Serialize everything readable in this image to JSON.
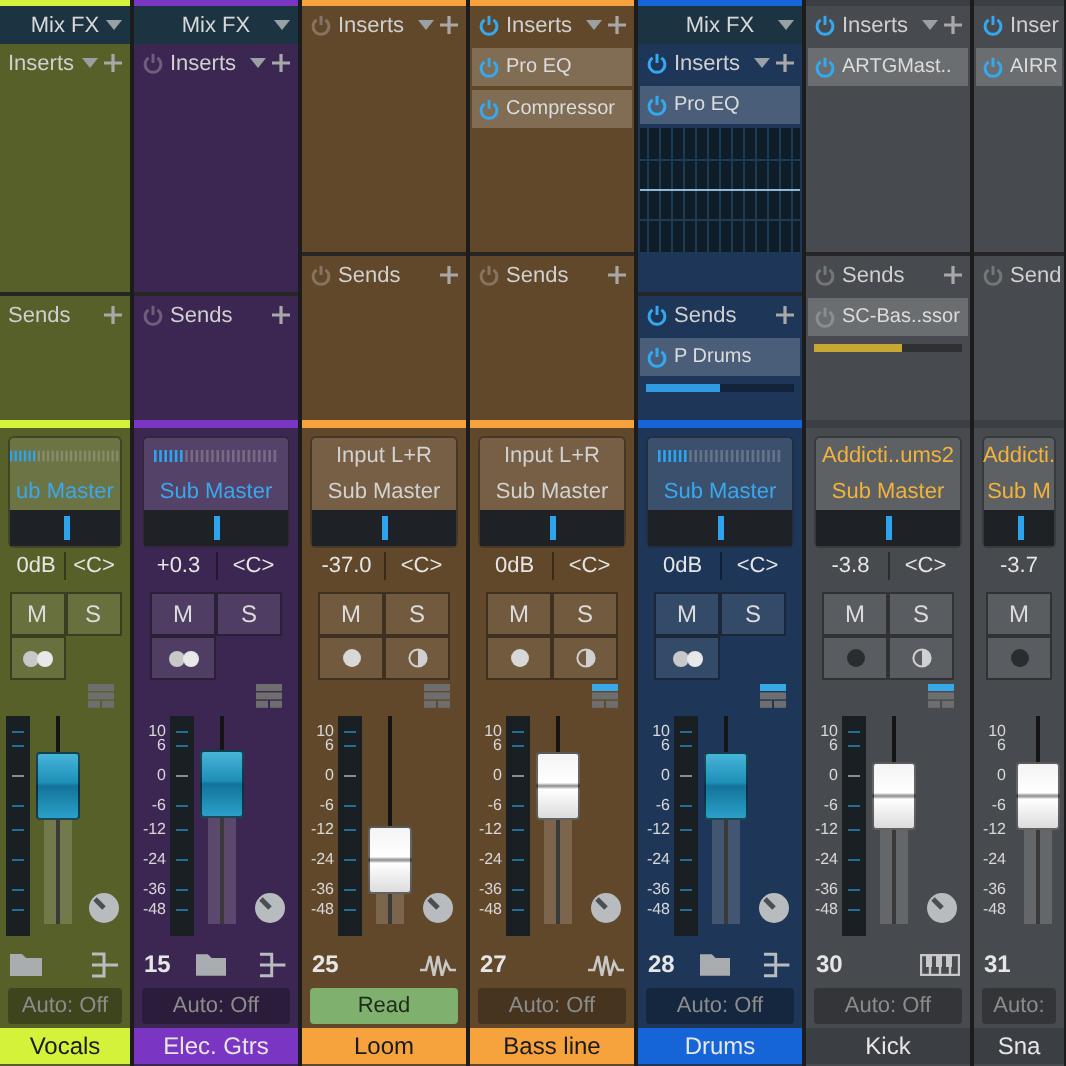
{
  "channels": [
    {
      "name": "Vocals",
      "color": "#d4f23a",
      "kind": "bus",
      "mix_fx": "Mix FX",
      "inserts": {
        "label": "Inserts"
      },
      "sends": {
        "label": "Sends"
      },
      "io": {
        "output": "ub Master"
      },
      "volume": "0dB",
      "pan": {
        "text": "<C>",
        "level": 0.5
      },
      "buttons": [
        {
          "label": "M"
        },
        {
          "label": "S"
        }
      ],
      "layout_active": false,
      "fader": {
        "level": 0.75
      },
      "automation": {
        "label": "Auto: Off",
        "active": false
      }
    },
    {
      "name": "Elec. Gtrs",
      "color": "#7a35c2",
      "kind": "bus",
      "mix_fx": "Mix FX",
      "inserts": {
        "label": "Inserts",
        "on": false
      },
      "sends": {
        "label": "Sends",
        "on": false
      },
      "io": {
        "output": "Sub Master"
      },
      "volume": "+0.3",
      "pan": {
        "text": "<C>",
        "level": 0.5
      },
      "buttons": [
        {
          "label": "M"
        },
        {
          "label": "S"
        }
      ],
      "layout_active": false,
      "scale": [
        "10",
        "6",
        "0",
        "-6",
        "-12",
        "-24",
        "-36",
        "-48"
      ],
      "fader": {
        "level": 0.76
      },
      "number": "15",
      "automation": {
        "label": "Auto: Off",
        "active": false
      }
    },
    {
      "name": "Loom",
      "color": "#f7a33d",
      "kind": "audio",
      "inserts": {
        "label": "Inserts",
        "on": false
      },
      "sends": {
        "label": "Sends",
        "on": false
      },
      "io": {
        "source": "Input L+R",
        "output": "Sub Master"
      },
      "volume": "-37.0",
      "pan": {
        "text": "<C>",
        "level": 0.5
      },
      "buttons": [
        {
          "label": "M"
        },
        {
          "label": "S"
        }
      ],
      "layout_active": false,
      "scale": [
        "10",
        "6",
        "0",
        "-6",
        "-12",
        "-24",
        "-36",
        "-48"
      ],
      "fader": {
        "level": 0.22
      },
      "number": "25",
      "automation": {
        "label": "Read",
        "active": true
      }
    },
    {
      "name": "Bass line",
      "color": "#f7a33d",
      "kind": "audio",
      "inserts": {
        "label": "Inserts",
        "on": true,
        "items": [
          {
            "name": "Pro EQ",
            "on": true
          },
          {
            "name": "Compressor",
            "on": true
          }
        ]
      },
      "sends": {
        "label": "Sends",
        "on": false
      },
      "io": {
        "source": "Input L+R",
        "output": "Sub Master"
      },
      "volume": "0dB",
      "pan": {
        "text": "<C>",
        "level": 0.5
      },
      "buttons": [
        {
          "label": "M"
        },
        {
          "label": "S"
        }
      ],
      "layout_active": true,
      "scale": [
        "10",
        "6",
        "0",
        "-6",
        "-12",
        "-24",
        "-36",
        "-48"
      ],
      "fader": {
        "level": 0.75
      },
      "number": "27",
      "automation": {
        "label": "Auto: Off",
        "active": false
      }
    },
    {
      "name": "Drums",
      "color": "#1565d8",
      "kind": "bus",
      "mix_fx": "Mix FX",
      "inserts": {
        "label": "Inserts",
        "on": true,
        "items": [
          {
            "name": "Pro EQ",
            "on": true
          }
        ]
      },
      "eq_display": true,
      "sends": {
        "label": "Sends",
        "on": true,
        "items": [
          {
            "name": "P Drums",
            "on": true,
            "level": 0.5,
            "color": "#2f9be0"
          }
        ]
      },
      "io": {
        "output": "Sub Master"
      },
      "volume": "0dB",
      "pan": {
        "text": "<C>",
        "level": 0.5
      },
      "buttons": [
        {
          "label": "M"
        },
        {
          "label": "S"
        }
      ],
      "layout_active": true,
      "scale": [
        "10",
        "6",
        "0",
        "-6",
        "-12",
        "-24",
        "-36",
        "-48"
      ],
      "fader": {
        "level": 0.75
      },
      "number": "28",
      "automation": {
        "label": "Auto: Off",
        "active": false
      }
    },
    {
      "name": "Kick",
      "color": "#3b3f43",
      "kind": "instrument",
      "inserts": {
        "label": "Inserts",
        "on": true,
        "items": [
          {
            "name": "ARTGMast..",
            "on": true
          }
        ]
      },
      "sends": {
        "label": "Sends",
        "on": false,
        "items": [
          {
            "name": "SC-Bas..ssor",
            "on": false,
            "level": 0.6,
            "color": "#c8a832"
          }
        ]
      },
      "io": {
        "source": "Addicti..ums2",
        "output": "Sub Master"
      },
      "volume": "-3.8",
      "pan": {
        "text": "<C>",
        "level": 0.5
      },
      "buttons": [
        {
          "label": "M"
        },
        {
          "label": "S"
        }
      ],
      "layout_active": true,
      "scale": [
        "10",
        "6",
        "0",
        "-6",
        "-12",
        "-24",
        "-36",
        "-48"
      ],
      "fader": {
        "level": 0.67
      },
      "number": "30",
      "automation": {
        "label": "Auto: Off",
        "active": false
      }
    },
    {
      "name": "Sna",
      "color": "#3b3f43",
      "kind": "instrument",
      "inserts": {
        "label": "Inser",
        "on": true,
        "items": [
          {
            "name": "AIRR",
            "on": true
          }
        ]
      },
      "sends": {
        "label": "Send",
        "on": false
      },
      "io": {
        "source": "Addicti.",
        "output": "Sub M"
      },
      "volume": "-3.7",
      "pan": {
        "level": 0.5
      },
      "buttons": [
        {
          "label": "M"
        }
      ],
      "scale": [
        "10",
        "6",
        "0",
        "-6",
        "-12",
        "-24",
        "-36",
        "-48"
      ],
      "fader": {
        "level": 0.67
      },
      "number": "31",
      "automation": {
        "label": "Auto:",
        "active": false
      }
    }
  ]
}
